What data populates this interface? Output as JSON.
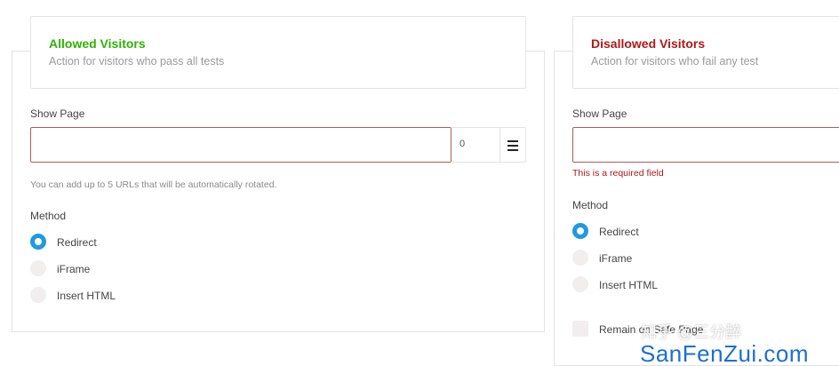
{
  "allowed": {
    "title": "Allowed Visitors",
    "subtitle": "Action for visitors who pass all tests",
    "show_page_label": "Show Page",
    "url_count": "0",
    "hint": "You can add up to 5 URLs that will be automatically rotated.",
    "method_label": "Method",
    "methods": [
      "Redirect",
      "iFrame",
      "Insert HTML"
    ],
    "selected_method": "Redirect"
  },
  "disallowed": {
    "title": "Disallowed Visitors",
    "subtitle": "Action for visitors who fail any test",
    "show_page_label": "Show Page",
    "error": "This is a required field",
    "method_label": "Method",
    "methods": [
      "Redirect",
      "iFrame",
      "Insert HTML"
    ],
    "selected_method": "Redirect",
    "remain_label": "Remain on Safe Page"
  },
  "watermark": {
    "line1": "知乎 @三分醉",
    "line2": "SanFenZui.com"
  },
  "colors": {
    "allowed_title": "#2db400",
    "disallowed_title": "#b11818",
    "radio_selected": "#1e9ae0",
    "input_error_border": "#b35a5a"
  }
}
